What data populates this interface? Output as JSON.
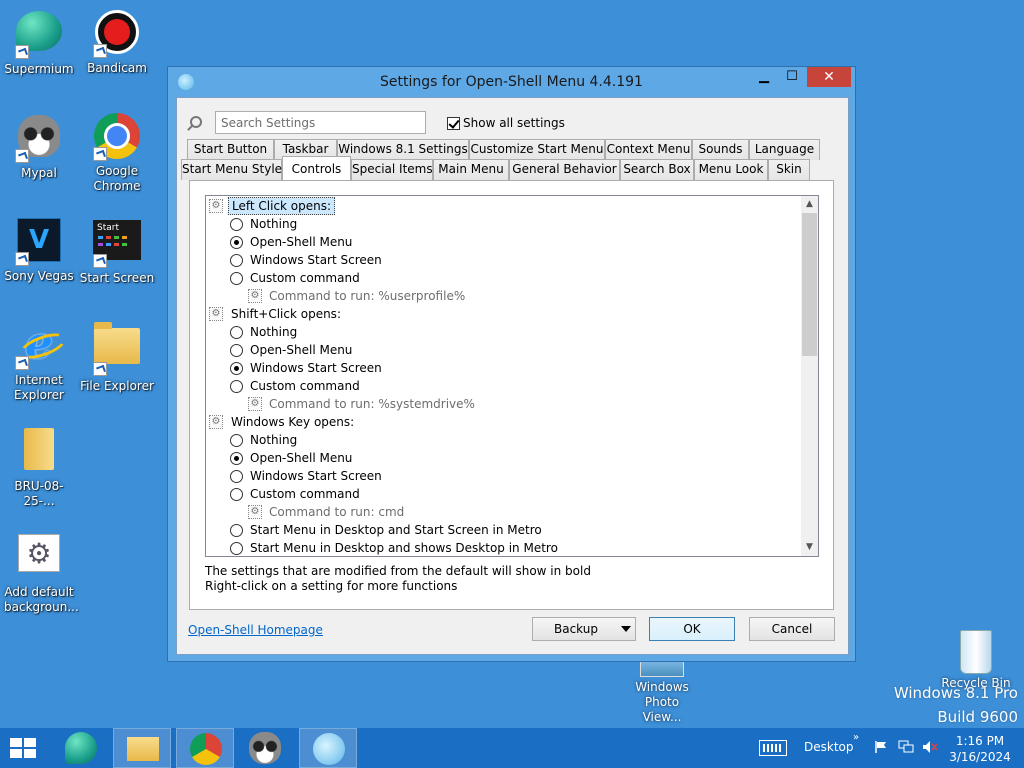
{
  "desktop": {
    "icons": [
      {
        "label": "Supermium"
      },
      {
        "label": "Bandicam"
      },
      {
        "label": "Mypal"
      },
      {
        "label": "Google Chrome"
      },
      {
        "label": "Sony Vegas"
      },
      {
        "label": "Start Screen"
      },
      {
        "label": "Internet Explorer"
      },
      {
        "label": "File Explorer"
      },
      {
        "label": "BRU-08-25-..."
      },
      {
        "label": "Add default backgroun..."
      },
      {
        "label": "Windows Photo View..."
      },
      {
        "label": "Recycle Bin"
      }
    ],
    "start_screen_tile_text": "Start",
    "watermark_line1": "Windows 8.1 Pro",
    "watermark_line2": "Build 9600"
  },
  "window": {
    "title": "Settings for Open-Shell Menu 4.4.191",
    "minimize_glyph": "▁",
    "maximize_glyph": "☐",
    "close_glyph": "✕",
    "search_placeholder": "Search Settings",
    "show_all_label": "Show all settings",
    "show_all_checked": true,
    "tabs_row1": [
      "Start Button",
      "Taskbar",
      "Windows 8.1 Settings",
      "Customize Start Menu",
      "Context Menu",
      "Sounds",
      "Language"
    ],
    "tabs_row2": [
      "Start Menu Style",
      "Controls",
      "Special Items",
      "Main Menu",
      "General Behavior",
      "Search Box",
      "Menu Look",
      "Skin"
    ],
    "active_tab": "Controls",
    "settings": [
      {
        "type": "group",
        "label": "Left Click opens:",
        "selected": true
      },
      {
        "type": "radio",
        "label": "Nothing",
        "checked": false
      },
      {
        "type": "radio",
        "label": "Open-Shell Menu",
        "checked": true
      },
      {
        "type": "radio",
        "label": "Windows Start Screen",
        "checked": false
      },
      {
        "type": "radio",
        "label": "Custom command",
        "checked": false
      },
      {
        "type": "cmd",
        "label": "Command to run: %userprofile%"
      },
      {
        "type": "group",
        "label": "Shift+Click opens:",
        "selected": false
      },
      {
        "type": "radio",
        "label": "Nothing",
        "checked": false
      },
      {
        "type": "radio",
        "label": "Open-Shell Menu",
        "checked": false
      },
      {
        "type": "radio",
        "label": "Windows Start Screen",
        "checked": true
      },
      {
        "type": "radio",
        "label": "Custom command",
        "checked": false
      },
      {
        "type": "cmd",
        "label": "Command to run: %systemdrive%"
      },
      {
        "type": "group",
        "label": "Windows Key opens:",
        "selected": false
      },
      {
        "type": "radio",
        "label": "Nothing",
        "checked": false
      },
      {
        "type": "radio",
        "label": "Open-Shell Menu",
        "checked": true
      },
      {
        "type": "radio",
        "label": "Windows Start Screen",
        "checked": false
      },
      {
        "type": "radio",
        "label": "Custom command",
        "checked": false
      },
      {
        "type": "cmd",
        "label": "Command to run: cmd"
      },
      {
        "type": "radio",
        "label": "Start Menu in Desktop and Start Screen in Metro",
        "checked": false
      },
      {
        "type": "radio",
        "label": "Start Menu in Desktop and shows Desktop in Metro",
        "checked": false
      }
    ],
    "hint_line1": "The settings that are modified from the default will show in bold",
    "hint_line2": "Right-click on a setting for more functions",
    "homepage_link": "Open-Shell Homepage",
    "backup_label": "Backup",
    "ok_label": "OK",
    "cancel_label": "Cancel"
  },
  "taskbar": {
    "desktop_label": "Desktop",
    "overflow_glyph": "»",
    "time": "1:16 PM",
    "date": "3/16/2024"
  },
  "colors": {
    "desktop_bg": "#3d8fd8",
    "taskbar_bg": "#1a6fc4",
    "window_frame": "#5ea8e6",
    "close_button": "#c7443a",
    "link": "#0066cc",
    "selection": "#cce8ff"
  }
}
